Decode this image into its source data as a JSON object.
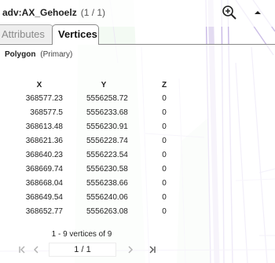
{
  "header": {
    "feature_name": "adv:AX_Gehoelz",
    "feature_count": "(1 / 1)"
  },
  "tabs": [
    {
      "label": "Attributes",
      "active": false
    },
    {
      "label": "Vertices",
      "active": true
    }
  ],
  "geometry": {
    "type": "Polygon",
    "role": "(Primary)"
  },
  "table": {
    "columns": [
      "X",
      "Y",
      "Z"
    ],
    "rows": [
      [
        "368577.23",
        "5556258.72",
        "0"
      ],
      [
        "368577.5",
        "5556233.68",
        "0"
      ],
      [
        "368613.48",
        "5556230.91",
        "0"
      ],
      [
        "368621.36",
        "5556228.74",
        "0"
      ],
      [
        "368640.23",
        "5556223.54",
        "0"
      ],
      [
        "368669.74",
        "5556230.58",
        "0"
      ],
      [
        "368668.04",
        "5556238.66",
        "0"
      ],
      [
        "368649.54",
        "5556240.06",
        "0"
      ],
      [
        "368652.77",
        "5556263.08",
        "0"
      ]
    ]
  },
  "footer": {
    "vertex_count_text": "1 - 9 vertices of 9",
    "page_text": "1  /  1"
  },
  "icons": {
    "zoom": "zoom-in-icon",
    "collapse": "caret-up-icon",
    "first": "first-page-icon",
    "prev": "previous-page-icon",
    "next": "next-page-icon",
    "last": "last-page-icon"
  },
  "colors": {
    "map_line": "#b9a8d8",
    "map_line_light": "#d9cfea",
    "map_road_fill": "#f4f1fa",
    "map_green": "#cfe8cf"
  }
}
